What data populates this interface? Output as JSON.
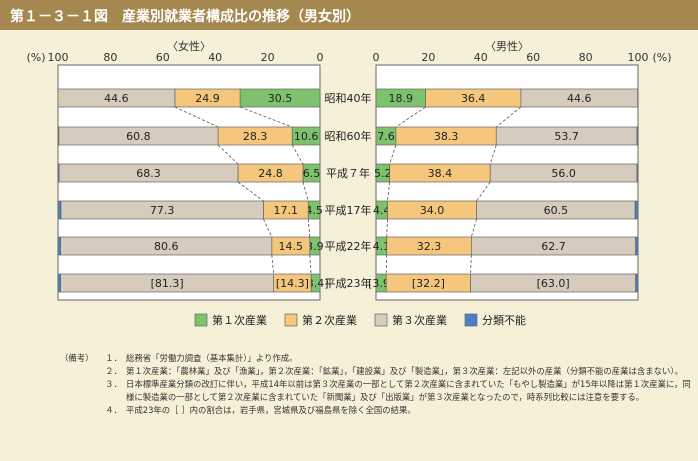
{
  "title": "第１－３－１図　産業別就業者構成比の推移（男女別）",
  "chart_data": {
    "type": "bar",
    "orientation": "horizontal",
    "stacked": true,
    "percent_label": "(%)",
    "categories": [
      "昭和40年",
      "昭和60年",
      "平成７年",
      "平成17年",
      "平成22年",
      "平成23年"
    ],
    "series_names": [
      "第１次産業",
      "第２次産業",
      "第３次産業",
      "分類不能"
    ],
    "colors": {
      "primary": "#7ec26e",
      "secondary": "#f4c77c",
      "tertiary": "#d6cbbc",
      "unclassified": "#4a7fc6",
      "border": "#666666"
    },
    "female": {
      "label": "〈女性〉",
      "xlim": [
        100,
        0
      ],
      "ticks": [
        "100",
        "80",
        "60",
        "40",
        "20",
        "0"
      ],
      "series": [
        {
          "name": "第１次産業",
          "values": [
            30.5,
            10.6,
            6.5,
            4.5,
            3.9,
            3.4
          ],
          "labels": [
            "30.5",
            "10.6",
            "6.5",
            "4.5",
            "3.9",
            "[3.4]"
          ]
        },
        {
          "name": "第２次産業",
          "values": [
            24.9,
            28.3,
            24.8,
            17.1,
            14.5,
            14.3
          ],
          "labels": [
            "24.9",
            "28.3",
            "24.8",
            "17.1",
            "14.5",
            "[14.3]"
          ]
        },
        {
          "name": "第３次産業",
          "values": [
            44.6,
            60.8,
            68.3,
            77.3,
            80.6,
            81.3
          ],
          "labels": [
            "44.6",
            "60.8",
            "68.3",
            "77.3",
            "80.6",
            "[81.3]"
          ]
        },
        {
          "name": "分類不能",
          "values": [
            0.0,
            0.3,
            0.4,
            1.1,
            1.0,
            1.0
          ],
          "labels": [
            "",
            "",
            "",
            "",
            "",
            ""
          ]
        }
      ]
    },
    "male": {
      "label": "〈男性〉",
      "xlim": [
        0,
        100
      ],
      "ticks": [
        "0",
        "20",
        "40",
        "60",
        "80",
        "100"
      ],
      "series": [
        {
          "name": "第１次産業",
          "values": [
            18.9,
            7.6,
            5.2,
            4.4,
            4.1,
            3.9
          ],
          "labels": [
            "18.9",
            "7.6",
            "5.2",
            "4.4",
            "4.1",
            "[3.9]"
          ]
        },
        {
          "name": "第２次産業",
          "values": [
            36.4,
            38.3,
            38.4,
            34.0,
            32.3,
            32.2
          ],
          "labels": [
            "36.4",
            "38.3",
            "38.4",
            "34.0",
            "32.3",
            "[32.2]"
          ]
        },
        {
          "name": "第３次産業",
          "values": [
            44.6,
            53.7,
            56.0,
            60.5,
            62.7,
            63.0
          ],
          "labels": [
            "44.6",
            "53.7",
            "56.0",
            "60.5",
            "62.7",
            "[63.0]"
          ]
        },
        {
          "name": "分類不能",
          "values": [
            0.1,
            0.4,
            0.4,
            1.1,
            0.9,
            0.9
          ],
          "labels": [
            "",
            "",
            "",
            "",
            "",
            ""
          ]
        }
      ]
    }
  },
  "notes": {
    "head": "（備考）",
    "items": [
      {
        "num": "１．",
        "text": "総務省「労働力調査（基本集計）」より作成。"
      },
      {
        "num": "２．",
        "text": "第１次産業：「農林業」及び「漁業」，第２次産業：「鉱業」，「建設業」及び「製造業」，第３次産業：左記以外の産業（分類不能の産業は含まない）。"
      },
      {
        "num": "３．",
        "text": "日本標準産業分類の改訂に伴い，平成14年以前は第３次産業の一部として第２次産業に含まれていた「もやし製造業」が15年以降は第１次産業に，同様に製造業の一部として第２次産業に含まれていた「新聞業」及び「出版業」が第３次産業となったので，時系列比較には注意を要する。"
      },
      {
        "num": "４．",
        "text": "平成23年の［ ］内の割合は，岩手県，宮城県及び福島県を除く全国の結果。"
      }
    ]
  }
}
